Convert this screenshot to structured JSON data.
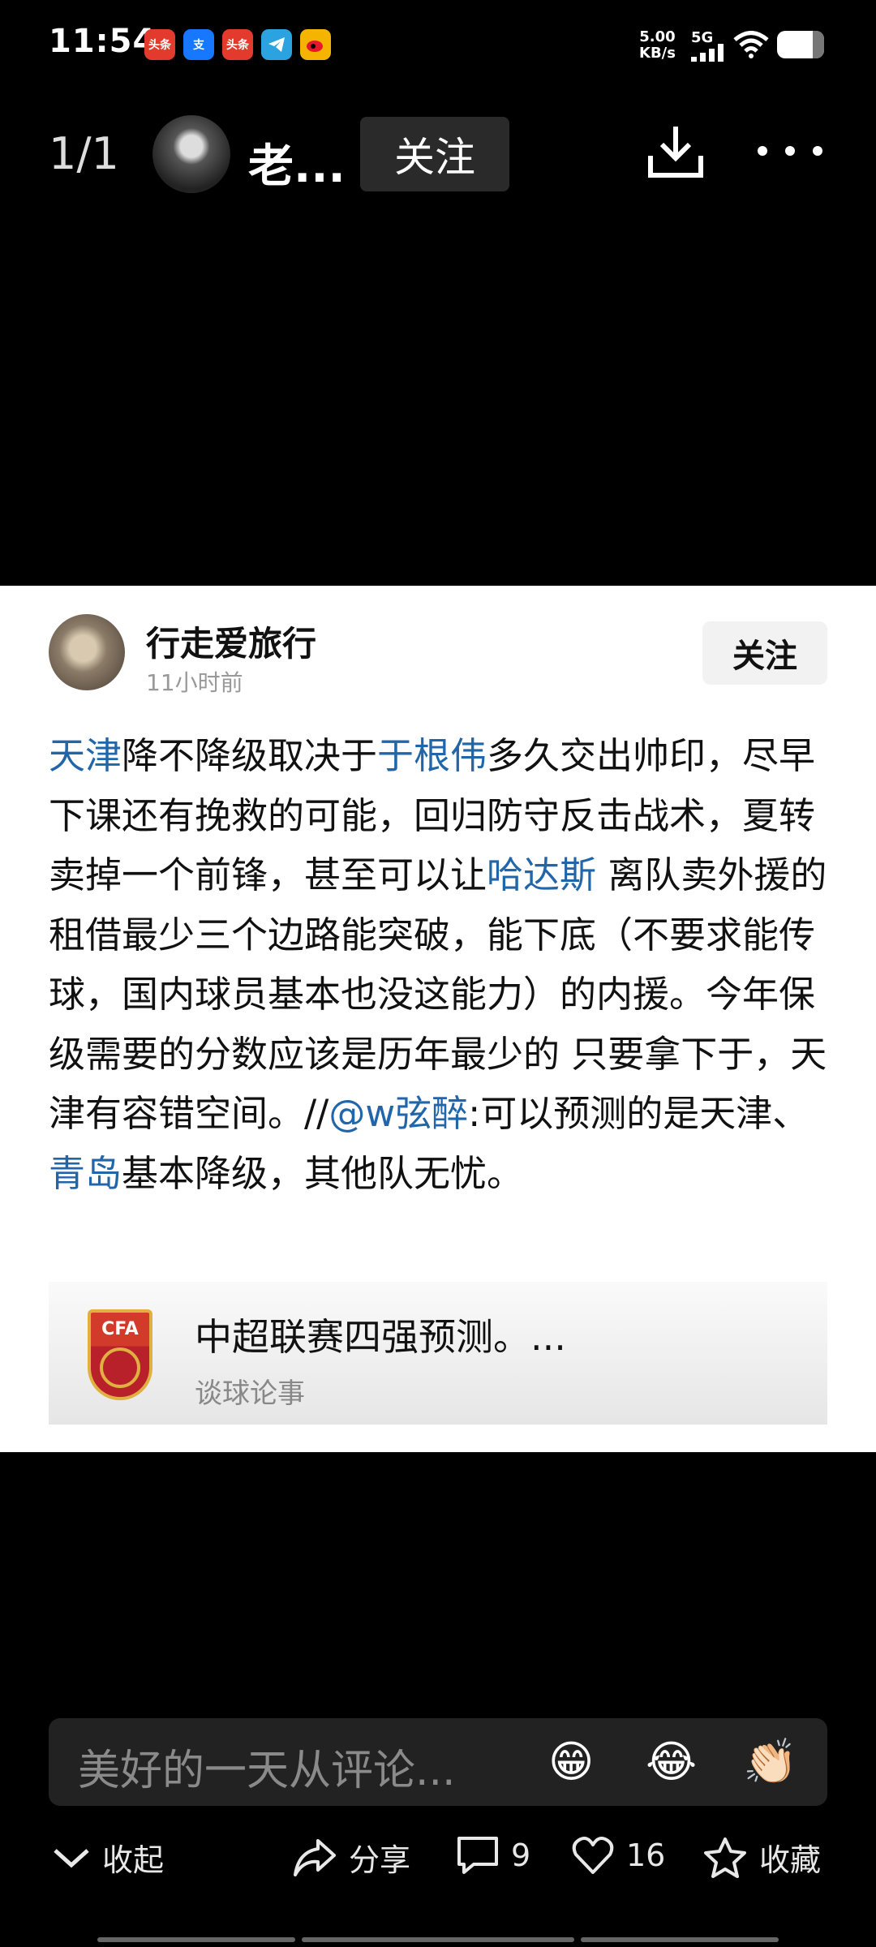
{
  "status_bar": {
    "time": "11:54",
    "net_speed": "5.00",
    "net_unit": "KB/s",
    "signal": "5G",
    "app_icons": [
      {
        "label": "头条",
        "color": "#e23b2e"
      },
      {
        "label": "支",
        "color": "#1677ff"
      },
      {
        "label": "头条",
        "color": "#e23b2e"
      },
      {
        "label": "",
        "color": "#2aa3e0"
      },
      {
        "label": "",
        "color": "#f5b400"
      }
    ]
  },
  "top_bar": {
    "counter": "1/1",
    "author": "老...",
    "follow_label": "关注"
  },
  "post": {
    "author": "行走爱旅行",
    "time": "11小时前",
    "follow_label": "关注",
    "segments": [
      {
        "text": "天津",
        "link": true
      },
      {
        "text": "降不降级取决于",
        "link": false
      },
      {
        "text": "于根伟",
        "link": true
      },
      {
        "text": "多久交出帅印，尽早下课还有挽救的可能，回归防守反击战术，夏转卖掉一个前锋，甚至可以让",
        "link": false
      },
      {
        "text": "哈达斯",
        "link": true
      },
      {
        "text": " 离队卖外援的租借最少三个边路能突破，能下底（不要求能传球，国内球员基本也没这能力）的内援。今年保级需要的分数应该是历年最少的 只要拿下于，天津有容错空间。//",
        "link": false
      },
      {
        "text": "@w弦醉",
        "link": true
      },
      {
        "text": ":可以预测的是天津、",
        "link": false
      },
      {
        "text": "青岛",
        "link": true
      },
      {
        "text": "基本降级，其他队无忧。",
        "link": false
      }
    ],
    "quote": {
      "title": "中超联赛四强预测。...",
      "source": "谈球论事",
      "logo_text": "CFA"
    }
  },
  "comment": {
    "placeholder": "美好的一天从评论...",
    "emojis": [
      "😁",
      "😂",
      "👏🏻"
    ]
  },
  "actions": {
    "collapse": "收起",
    "share": "分享",
    "comments": "9",
    "likes": "16",
    "favorite": "收藏"
  }
}
